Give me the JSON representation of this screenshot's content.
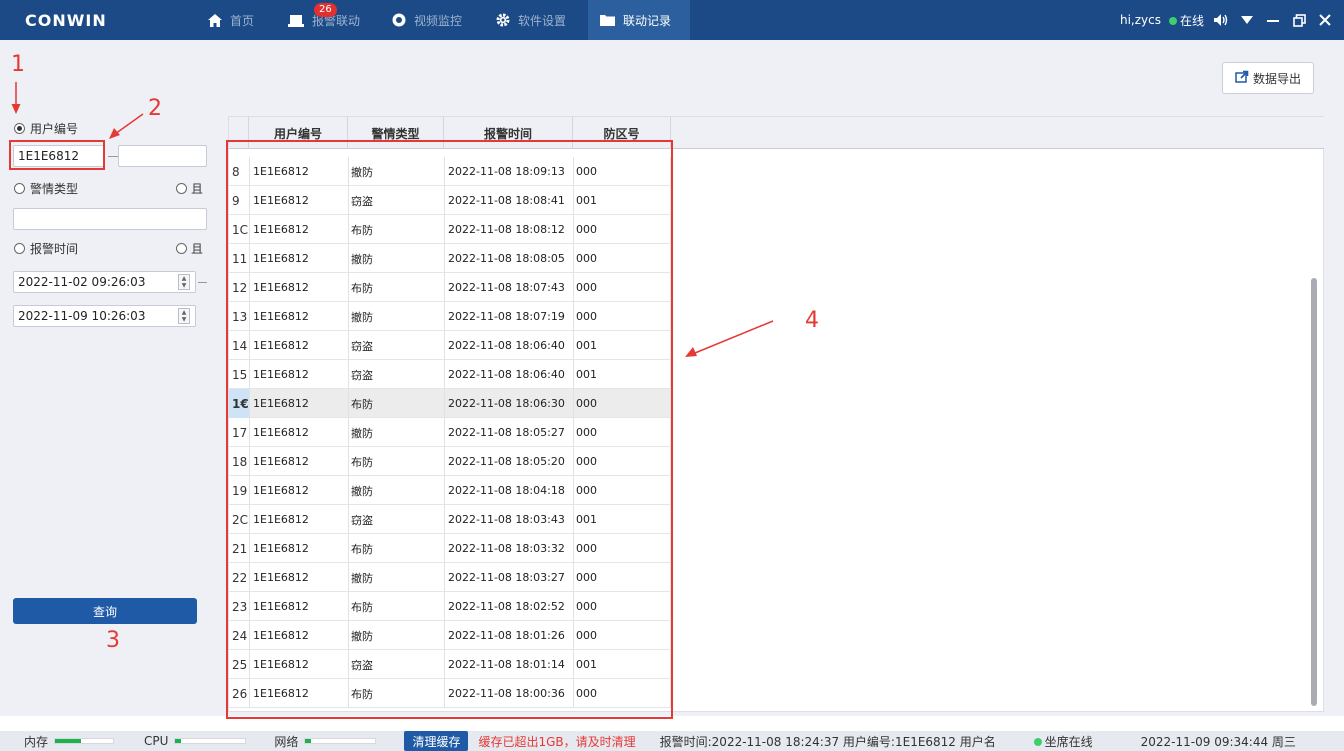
{
  "app": {
    "logo": "CONWIN"
  },
  "nav": {
    "home": "首页",
    "alarm": "报警联动",
    "alarm_badge": "26",
    "video": "视频监控",
    "settings": "软件设置",
    "records": "联动记录"
  },
  "user": {
    "greeting": "hi,zycs",
    "status": "在线"
  },
  "toolbar": {
    "export_label": "数据导出"
  },
  "filters": {
    "user_id_label": "用户编号",
    "user_id_value": "1E1E6812",
    "user_id_value2": "",
    "alarm_type_label": "警情类型",
    "alarm_type_and": "且",
    "alarm_type_value": "",
    "alarm_time_label": "报警时间",
    "alarm_time_and": "且",
    "time_start": "2022-11-02 09:26:03",
    "time_end": "2022-11-09 10:26:03",
    "query_label": "查询"
  },
  "table": {
    "headers": [
      "用户编号",
      "警情类型",
      "报警时间",
      "防区号"
    ],
    "selected_row": 8,
    "rows": [
      {
        "num": "8",
        "user": "1E1E6812",
        "type": "撤防",
        "time": "2022-11-08 18:09:13",
        "zone": "000"
      },
      {
        "num": "9",
        "user": "1E1E6812",
        "type": "窃盗",
        "time": "2022-11-08 18:08:41",
        "zone": "001"
      },
      {
        "num": "1C",
        "user": "1E1E6812",
        "type": "布防",
        "time": "2022-11-08 18:08:12",
        "zone": "000"
      },
      {
        "num": "11",
        "user": "1E1E6812",
        "type": "撤防",
        "time": "2022-11-08 18:08:05",
        "zone": "000"
      },
      {
        "num": "12",
        "user": "1E1E6812",
        "type": "布防",
        "time": "2022-11-08 18:07:43",
        "zone": "000"
      },
      {
        "num": "13",
        "user": "1E1E6812",
        "type": "撤防",
        "time": "2022-11-08 18:07:19",
        "zone": "000"
      },
      {
        "num": "14",
        "user": "1E1E6812",
        "type": "窃盗",
        "time": "2022-11-08 18:06:40",
        "zone": "001"
      },
      {
        "num": "15",
        "user": "1E1E6812",
        "type": "窃盗",
        "time": "2022-11-08 18:06:40",
        "zone": "001"
      },
      {
        "num": "1€",
        "user": "1E1E6812",
        "type": "布防",
        "time": "2022-11-08 18:06:30",
        "zone": "000"
      },
      {
        "num": "17",
        "user": "1E1E6812",
        "type": "撤防",
        "time": "2022-11-08 18:05:27",
        "zone": "000"
      },
      {
        "num": "18",
        "user": "1E1E6812",
        "type": "布防",
        "time": "2022-11-08 18:05:20",
        "zone": "000"
      },
      {
        "num": "19",
        "user": "1E1E6812",
        "type": "撤防",
        "time": "2022-11-08 18:04:18",
        "zone": "000"
      },
      {
        "num": "2C",
        "user": "1E1E6812",
        "type": "窃盗",
        "time": "2022-11-08 18:03:43",
        "zone": "001"
      },
      {
        "num": "21",
        "user": "1E1E6812",
        "type": "布防",
        "time": "2022-11-08 18:03:32",
        "zone": "000"
      },
      {
        "num": "22",
        "user": "1E1E6812",
        "type": "撤防",
        "time": "2022-11-08 18:03:27",
        "zone": "000"
      },
      {
        "num": "23",
        "user": "1E1E6812",
        "type": "布防",
        "time": "2022-11-08 18:02:52",
        "zone": "000"
      },
      {
        "num": "24",
        "user": "1E1E6812",
        "type": "撤防",
        "time": "2022-11-08 18:01:26",
        "zone": "000"
      },
      {
        "num": "25",
        "user": "1E1E6812",
        "type": "窃盗",
        "time": "2022-11-08 18:01:14",
        "zone": "001"
      },
      {
        "num": "26",
        "user": "1E1E6812",
        "type": "布防",
        "time": "2022-11-08 18:00:36",
        "zone": "000"
      }
    ]
  },
  "annotations": [
    "1",
    "2",
    "3",
    "4"
  ],
  "status": {
    "memory_label": "内存",
    "memory_fraction": 0.45,
    "cpu_label": "CPU",
    "cpu_fraction": 0.08,
    "network_label": "网络",
    "network_fraction": 0.08,
    "clear_cache_label": "清理缓存",
    "cache_warning": "缓存已超出1GB，请及时清理",
    "last_alarm": "报警时间:2022-11-08 18:24:37 用户编号:1E1E6812 用户名",
    "seat_status": "坐席在线",
    "datetime": "2022-11-09 09:34:44 周三"
  },
  "colors": {
    "accent": "#1e5aa6",
    "titlebar": "#1b4a86",
    "annotation": "#e53935",
    "online": "#3ccf6a"
  }
}
